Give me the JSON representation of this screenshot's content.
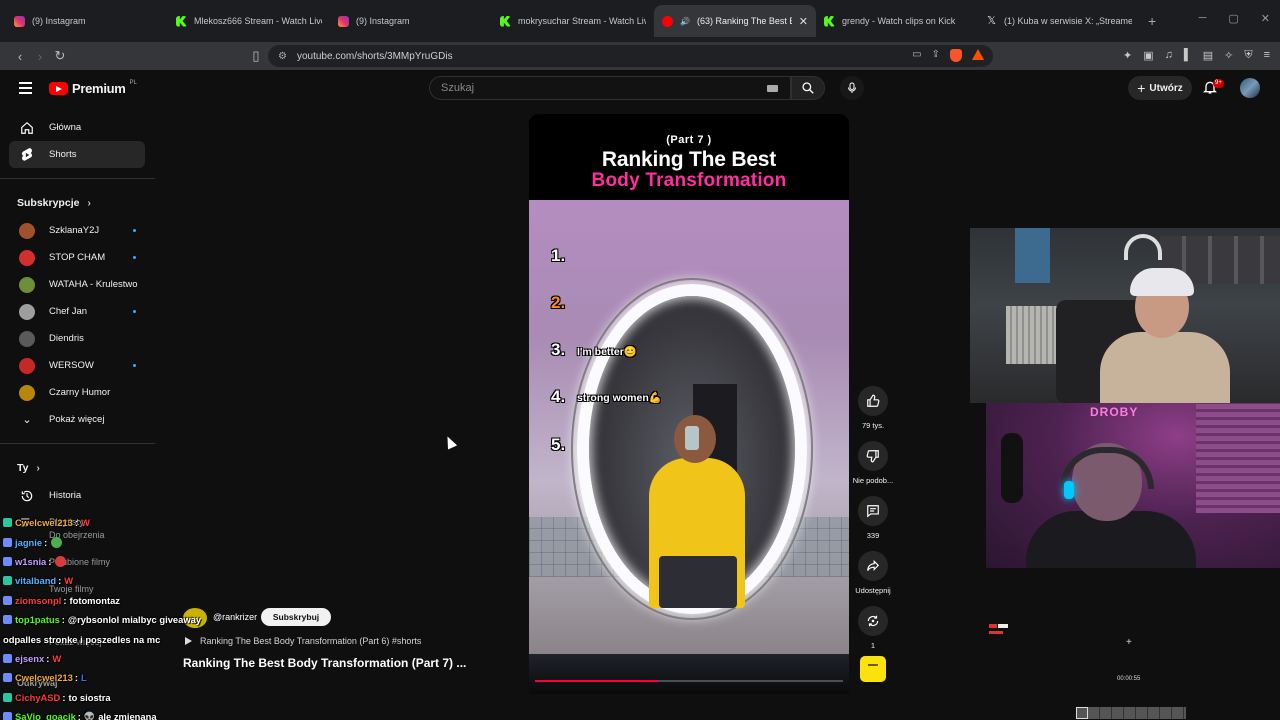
{
  "browser": {
    "tabs": [
      {
        "title": "(9) Instagram",
        "favicon": "instagram-icon",
        "active": false
      },
      {
        "title": "Mlekosz666 Stream - Watch Live on Kick",
        "favicon": "kick-icon",
        "active": false
      },
      {
        "title": "(9) Instagram",
        "favicon": "instagram-icon",
        "active": false
      },
      {
        "title": "mokrysuchar Stream - Watch Live on Kick",
        "favicon": "kick-icon",
        "active": false
      },
      {
        "title": "(63) Ranking The Best Body Transformation",
        "favicon": "youtube-icon",
        "active": true
      },
      {
        "title": "grendy - Watch clips on Kick",
        "favicon": "kick-icon",
        "active": false
      },
      {
        "title": "(1) Kuba w serwisie X: „Streamer Gr",
        "favicon": "x-icon",
        "active": false
      }
    ],
    "new_tab_label": "+",
    "url": "youtube.com/shorts/3MMpYruGDis"
  },
  "youtube": {
    "logo_text": "Premium",
    "logo_country": "PL",
    "search_placeholder": "Szukaj",
    "create_label": "Utwórz",
    "notifications_badge": "9+"
  },
  "sidebar": {
    "main": [
      {
        "label": "Główna",
        "icon": "home-icon",
        "active": false
      },
      {
        "label": "Shorts",
        "icon": "shorts-icon",
        "active": true
      }
    ],
    "subscriptions_heading": "Subskrypcje",
    "subscriptions": [
      {
        "label": "SzklanaY2J",
        "color": "#a0522d",
        "new": true
      },
      {
        "label": "STOP CHAM",
        "color": "#d32f2f",
        "new": true
      },
      {
        "label": "WATAHA - Krulestwo",
        "color": "#6d8f3a",
        "new": false
      },
      {
        "label": "Chef Jan",
        "color": "#9e9e9e",
        "new": true
      },
      {
        "label": "Diendris",
        "color": "#5a5a5a",
        "new": false
      },
      {
        "label": "WERSOW",
        "color": "#c62828",
        "new": true
      },
      {
        "label": "Czarny Humor",
        "color": "#b8860b",
        "new": false
      }
    ],
    "show_more": "Pokaż więcej",
    "you_heading": "Ty",
    "you_items": [
      {
        "label": "Historia",
        "icon": "history-icon"
      },
      {
        "label": "Playlisty",
        "icon": "playlist-icon"
      }
    ],
    "ghost_items": [
      "Do obejrzenia",
      "Polubione filmy",
      "Twoje filmy",
      "Pokaż więcej",
      "Odkrywaj"
    ]
  },
  "short": {
    "overlay_part": "(Part 7 )",
    "overlay_title_1": "Ranking The Best",
    "overlay_title_2": "Body Transformation",
    "ranks": [
      "1.",
      "2.",
      "3.",
      "4.",
      "5."
    ],
    "rank_notes": {
      "3": "I'm better😊",
      "4": "strong women💪"
    },
    "progress_percent": 40,
    "channel_handle": "@rankrizer",
    "subscribe_label": "Subskrybuj",
    "related_video": "Ranking The Best Body Transformation (Part 6) #shorts",
    "title": "Ranking The Best Body Transformation (Part 7) ..."
  },
  "actions": {
    "like_count": "79 tys.",
    "dislike_label": "Nie podob...",
    "comments_count": "339",
    "share_label": "Udostępnij",
    "remix_count": "1"
  },
  "stream_overlay": {
    "sign_text": "DROBY",
    "game_timer": "00:00:55",
    "chat": [
      {
        "user": "Cwelcwel213",
        "color": "#f2a93b",
        "message": "W",
        "style": "w"
      },
      {
        "user": "jagnie",
        "color": "#4fb3ff",
        "message": "",
        "style": "emote"
      },
      {
        "user": "w1snia",
        "color": "#c59cff",
        "message": "",
        "style": "emote-red"
      },
      {
        "user": "vitalband",
        "color": "#4fb3ff",
        "message": "W",
        "style": "w"
      },
      {
        "user": "ziomsonpl",
        "color": "#ff3b3b",
        "message": "fotomontaz",
        "style": "text"
      },
      {
        "user": "top1patus",
        "color": "#53fc18",
        "message": "@rybsonlol mialbyc giveaway",
        "style": "text"
      },
      {
        "user": "",
        "color": "#ffffff",
        "message": "odpalles stronke i poszedles na mc",
        "style": "plain"
      },
      {
        "user": "ejsenx",
        "color": "#c59cff",
        "message": "W",
        "style": "w"
      },
      {
        "user": "Cwelcwel213",
        "color": "#f2a93b",
        "message": "L",
        "style": "l"
      },
      {
        "user": "CichyASD",
        "color": "#ff3b3b",
        "message": "to siostra",
        "style": "text"
      },
      {
        "user": "SaVio_goacik",
        "color": "#53fc18",
        "message": "👽 ale zmienana",
        "style": "text"
      }
    ]
  }
}
